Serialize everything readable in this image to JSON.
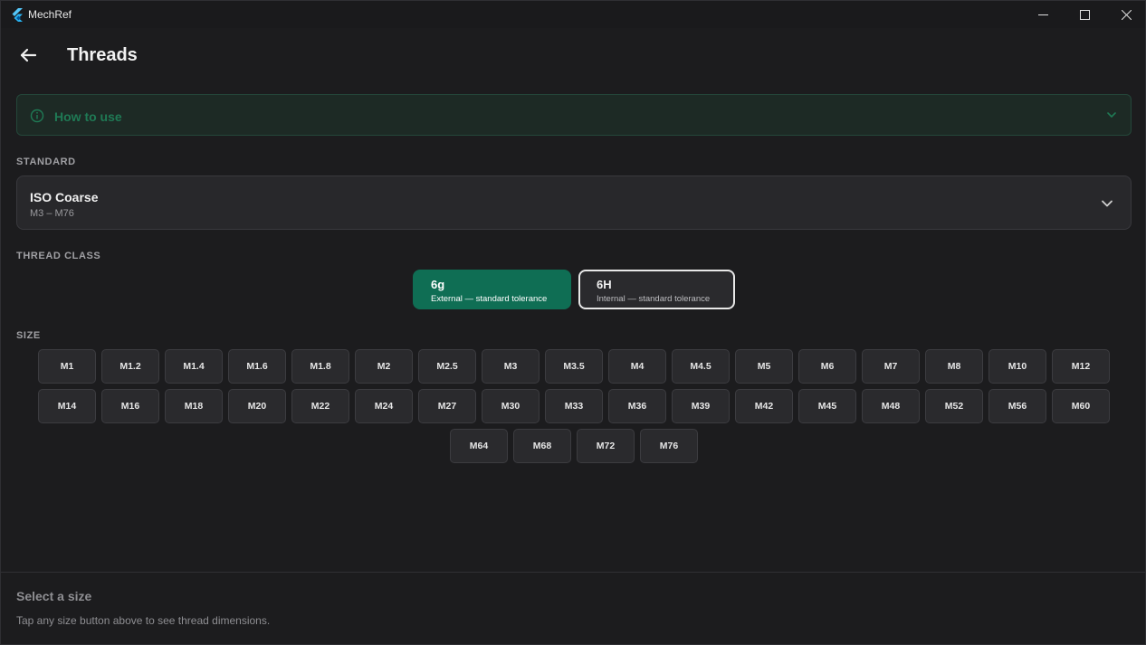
{
  "window": {
    "app_title": "MechRef",
    "icon": "flutter-logo-icon"
  },
  "header": {
    "title": "Threads",
    "back_icon": "arrow-left-icon"
  },
  "howto": {
    "label": "How to use",
    "accent": "#1f7a55"
  },
  "standard": {
    "section_label": "STANDARD",
    "value": "ISO Coarse",
    "range": "M3 – M76"
  },
  "thread_class": {
    "section_label": "THREAD CLASS",
    "options": [
      {
        "name": "6g",
        "desc": "External — standard tolerance",
        "selected": true
      },
      {
        "name": "6H",
        "desc": "Internal — standard tolerance",
        "selected": false
      }
    ],
    "selected_color": "#0f6e54"
  },
  "size": {
    "section_label": "SIZE",
    "rows": [
      [
        "M1",
        "M1.2",
        "M1.4",
        "M1.6",
        "M1.8",
        "M2",
        "M2.5",
        "M3",
        "M3.5",
        "M4",
        "M4.5",
        "M5",
        "M6",
        "M7",
        "M8",
        "M10",
        "M12"
      ],
      [
        "M14",
        "M16",
        "M18",
        "M20",
        "M22",
        "M24",
        "M27",
        "M30",
        "M33",
        "M36",
        "M39",
        "M42",
        "M45",
        "M48",
        "M52",
        "M56",
        "M60"
      ],
      [
        "M64",
        "M68",
        "M72",
        "M76"
      ]
    ]
  },
  "footer": {
    "title": "Select a size",
    "text": "Tap any size button above to see thread dimensions."
  }
}
